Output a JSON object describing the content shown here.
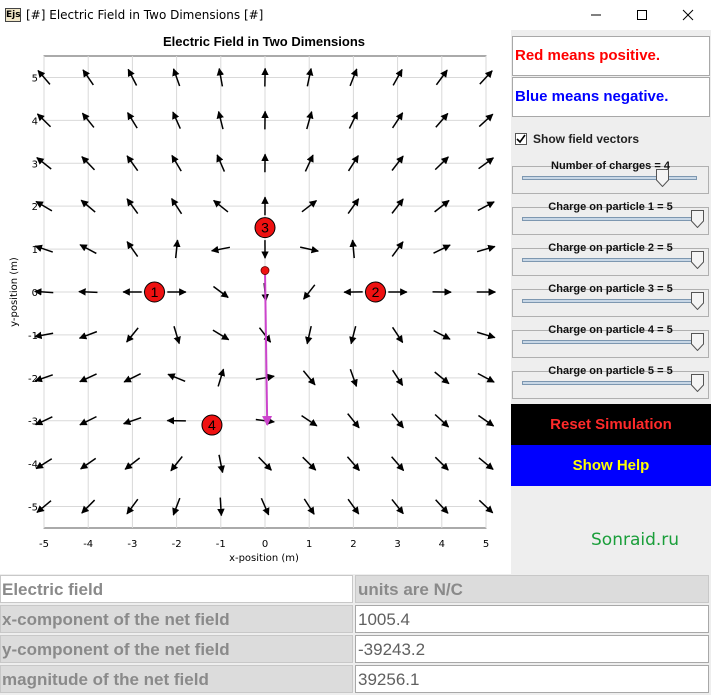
{
  "window": {
    "icon_text": "Ejs",
    "title": "[#] Electric Field in Two Dimensions [#]"
  },
  "plot": {
    "title": "Electric Field in Two Dimensions",
    "xlabel": "x-position (m)",
    "ylabel": "y-position (m)",
    "xlim": [
      -5,
      5
    ],
    "ylim": [
      -5.5,
      5.5
    ],
    "x_ticks": [
      -5,
      -4,
      -3,
      -2,
      -1,
      0,
      1,
      2,
      3,
      4,
      5
    ],
    "y_ticks": [
      5,
      4,
      3,
      2,
      1,
      0,
      -1,
      -2,
      -3,
      -4,
      -5
    ],
    "grid": true,
    "charges": [
      {
        "label": "1",
        "x": -2.5,
        "y": 0,
        "q": 5
      },
      {
        "label": "2",
        "x": 2.5,
        "y": 0,
        "q": 5
      },
      {
        "label": "3",
        "x": 0,
        "y": 1.5,
        "q": 5
      },
      {
        "label": "4",
        "x": -1.2,
        "y": -3.1,
        "q": 5
      }
    ],
    "probe": {
      "x": 0,
      "y": 0.5
    },
    "net_field_vector_color": "#cc44cc",
    "charge_color": "#ee1111",
    "vector_color": "#000000",
    "vector_fade_color": "#888888"
  },
  "legend": {
    "positive": "Red means positive.",
    "negative": "Blue means negative."
  },
  "controls": {
    "show_vectors_label": "Show field vectors",
    "show_vectors_checked": true,
    "sliders": [
      {
        "label": "Number of charges = 4",
        "fraction": 0.8
      },
      {
        "label": "Charge on particle 1 = 5",
        "fraction": 1.0
      },
      {
        "label": "Charge on particle 2 = 5",
        "fraction": 1.0
      },
      {
        "label": "Charge on particle 3 = 5",
        "fraction": 1.0
      },
      {
        "label": "Charge on particle 4 = 5",
        "fraction": 1.0
      },
      {
        "label": "Charge on particle 5 = 5",
        "fraction": 1.0
      }
    ],
    "reset_label": "Reset Simulation",
    "help_label": "Show Help",
    "watermark": "Sonraid.ru"
  },
  "table": {
    "rows": [
      {
        "label": "Electric field",
        "value": "units are N/C"
      },
      {
        "label": "x-component of the net field",
        "value": "1005.4"
      },
      {
        "label": "y-component of the net field",
        "value": "-39243.2"
      },
      {
        "label": "magnitude of the net field",
        "value": "39256.1"
      }
    ]
  }
}
